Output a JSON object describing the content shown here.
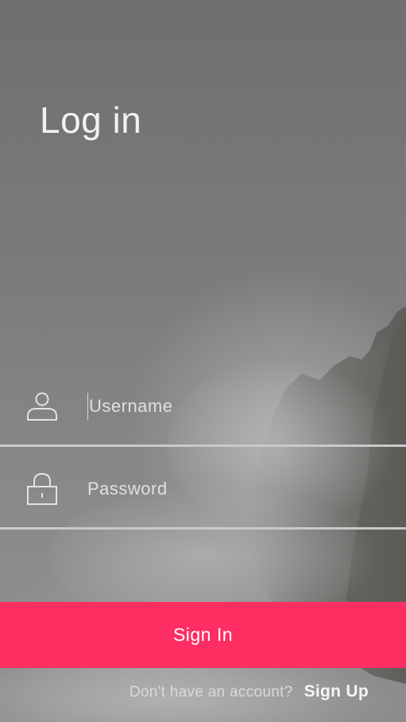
{
  "screen": {
    "title": "Log in"
  },
  "form": {
    "username": {
      "placeholder": "Username",
      "value": "",
      "icon": "user-icon"
    },
    "password": {
      "placeholder": "Password",
      "value": "",
      "icon": "lock-icon"
    }
  },
  "actions": {
    "sign_in_label": "Sign In",
    "signup_prompt": "Don't have an account?",
    "signup_link": "Sign Up"
  },
  "colors": {
    "accent": "#fe2e63",
    "divider": "#c9c9c9",
    "text": "#f2f2f2"
  }
}
